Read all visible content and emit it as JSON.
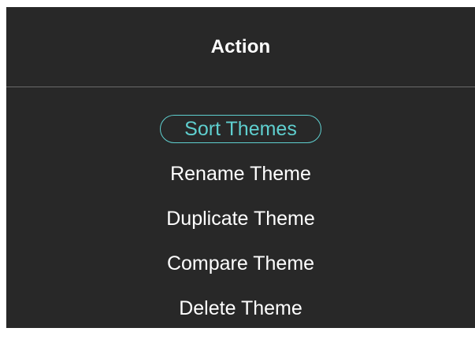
{
  "dialog": {
    "title": "Action",
    "selected_index": 0,
    "accent_color": "#5fcfcf",
    "background_color": "#282828",
    "items": [
      {
        "label": "Sort Themes"
      },
      {
        "label": "Rename Theme"
      },
      {
        "label": "Duplicate Theme"
      },
      {
        "label": "Compare Theme"
      },
      {
        "label": "Delete Theme"
      }
    ]
  }
}
